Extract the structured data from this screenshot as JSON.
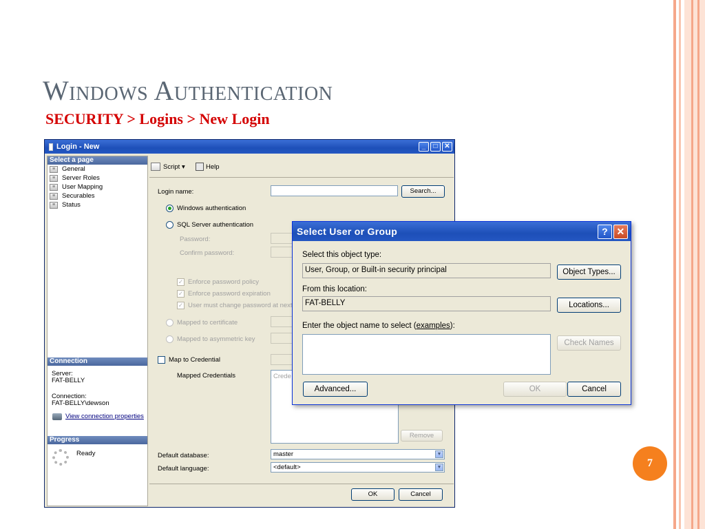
{
  "slide": {
    "title": "Windows Authentication",
    "subtitle": "SECURITY > Logins > New Login",
    "page_number": "7",
    "colors": {
      "title": "#5a6673",
      "subtitle": "#d40000",
      "badge": "#f5801e",
      "stripe": "#f5a78a"
    }
  },
  "login_window": {
    "title": "Login - New",
    "select_page_header": "Select a page",
    "pages": [
      "General",
      "Server Roles",
      "User Mapping",
      "Securables",
      "Status"
    ],
    "connection_header": "Connection",
    "server_label": "Server:",
    "server_value": "FAT-BELLY",
    "connection_label": "Connection:",
    "connection_value": "FAT-BELLY\\dewson",
    "view_props_link": "View connection properties",
    "progress_header": "Progress",
    "progress_status": "Ready",
    "toolbar": {
      "script": "Script",
      "help": "Help"
    },
    "login_name_label": "Login name:",
    "login_name_value": "",
    "search_button": "Search...",
    "windows_auth": "Windows authentication",
    "sql_auth": "SQL Server authentication",
    "password_label": "Password:",
    "confirm_password_label": "Confirm password:",
    "enforce_policy": "Enforce password policy",
    "enforce_expiration": "Enforce password expiration",
    "must_change": "User must change password at next lo",
    "mapped_cert": "Mapped to certificate",
    "mapped_key": "Mapped to asymmetric key",
    "map_credential": "Map to Credential",
    "mapped_credentials": "Mapped Credentials",
    "credential_column": "Crede",
    "remove_button": "Remove",
    "default_db_label": "Default database:",
    "default_db_value": "master",
    "default_lang_label": "Default language:",
    "default_lang_value": "<default>",
    "ok_button": "OK",
    "cancel_button": "Cancel"
  },
  "select_user_dialog": {
    "title": "Select User or Group",
    "object_type_label": "Select this object type:",
    "object_type_value": "User, Group, or Built-in security principal",
    "object_types_button": "Object Types...",
    "location_label": "From this location:",
    "location_value": "FAT-BELLY",
    "locations_button": "Locations...",
    "enter_name_label": "Enter the object name to select (",
    "examples_link": "examples",
    "enter_name_suffix": "):",
    "object_name_value": "",
    "check_names_button": "Check Names",
    "advanced_button": "Advanced...",
    "ok_button": "OK",
    "cancel_button": "Cancel"
  }
}
